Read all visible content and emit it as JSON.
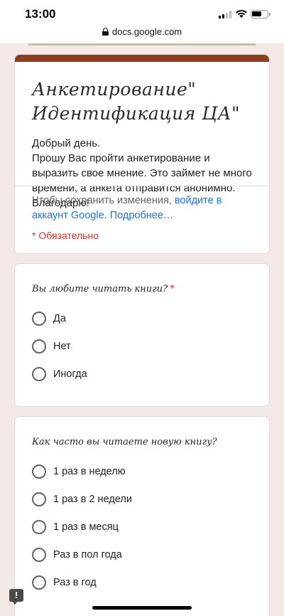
{
  "status": {
    "time": "13:00"
  },
  "browser": {
    "url": "docs.google.com"
  },
  "form": {
    "title": "Анкетирование\" Идентификация ЦА\"",
    "description": "Добрый день.\nПрошу Вас пройти анкетирование и выразить свое мнение. Это займет не много времени, а анкета отправится анонимно. Благодарю!",
    "signin_text": "Чтобы сохранить изменения, ",
    "signin_link": "войдите в аккаунт Google.",
    "learn_more": " Подробнее…",
    "required_note": "* Обязательно",
    "accent_color": "#8c3e1f"
  },
  "questions": [
    {
      "title": "Вы любите читать книги?",
      "required_mark": "*",
      "options": [
        "Да",
        "Нет",
        "Иногда"
      ]
    },
    {
      "title": "Как часто вы читаете новую книгу?",
      "options": [
        "1 раз в неделю",
        "1 раз в 2 недели",
        "1 раз в месяц",
        "Раз в пол года",
        "Раз в год"
      ]
    }
  ],
  "feedback_icon": "feedback-icon"
}
